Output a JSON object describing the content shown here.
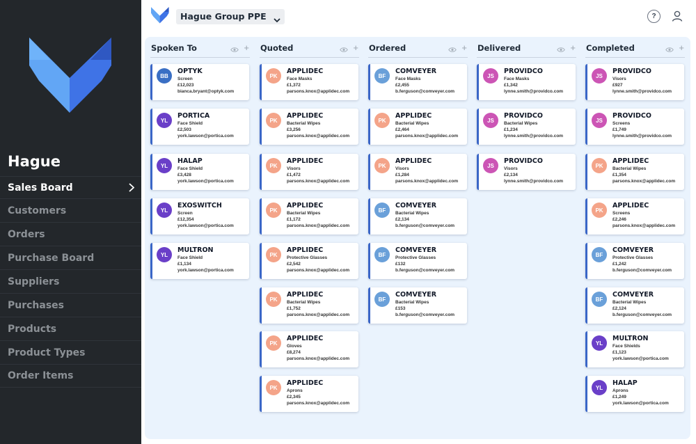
{
  "app": {
    "name": "Hague",
    "workspace": "Hague Group PPE",
    "help_label": "?"
  },
  "sidebar": {
    "items": [
      {
        "label": "Sales Board",
        "active": true
      },
      {
        "label": "Customers"
      },
      {
        "label": "Orders"
      },
      {
        "label": "Purchase Board"
      },
      {
        "label": "Suppliers"
      },
      {
        "label": "Purchases"
      },
      {
        "label": "Products"
      },
      {
        "label": "Product Types"
      },
      {
        "label": "Order Items"
      }
    ]
  },
  "colors": {
    "sidebar_bg": "#23272b",
    "board_bg": "#eaf3fd",
    "card_accent": "#3a66c7",
    "avatar_BB": "#3a6fc4",
    "avatar_YL": "#6a3fc8",
    "avatar_PK": "#f4a489",
    "avatar_BF": "#6aa0d9",
    "avatar_JS": "#cc55b5"
  },
  "board": {
    "columns": [
      {
        "title": "Spoken To",
        "cards": [
          {
            "initials": "BB",
            "company": "OPTYK",
            "product": "Screen",
            "amount": "£12,023",
            "email": "bianca.bryant@optyk.com"
          },
          {
            "initials": "YL",
            "company": "PORTICA",
            "product": "Face Shield",
            "amount": "£2,503",
            "email": "york.lawson@portica.com"
          },
          {
            "initials": "YL",
            "company": "HALAP",
            "product": "Face Shield",
            "amount": "£3,428",
            "email": "york.lawson@portica.com"
          },
          {
            "initials": "YL",
            "company": "EXOSWITCH",
            "product": "Screen",
            "amount": "£12,354",
            "email": "york.lawson@portica.com"
          },
          {
            "initials": "YL",
            "company": "MULTRON",
            "product": "Face Shield",
            "amount": "£1,134",
            "email": "york.lawson@portica.com"
          }
        ]
      },
      {
        "title": "Quoted",
        "cards": [
          {
            "initials": "PK",
            "company": "APPLIDEC",
            "product": "Face Masks",
            "amount": "£1,372",
            "email": "parsons.knox@applidec.com"
          },
          {
            "initials": "PK",
            "company": "APPLIDEC",
            "product": "Bacterial Wipes",
            "amount": "£3,256",
            "email": "parsons.knox@applidec.com"
          },
          {
            "initials": "PK",
            "company": "APPLIDEC",
            "product": "Visors",
            "amount": "£1,472",
            "email": "parsons.knox@applidec.com"
          },
          {
            "initials": "PK",
            "company": "APPLIDEC",
            "product": "Bacterial Wipes",
            "amount": "£1,172",
            "email": "parsons.knox@applidec.com"
          },
          {
            "initials": "PK",
            "company": "APPLIDEC",
            "product": "Protective Glasses",
            "amount": "£2,542",
            "email": "parsons.knox@applidec.com"
          },
          {
            "initials": "PK",
            "company": "APPLIDEC",
            "product": "Bacterial Wipes",
            "amount": "£1,752",
            "email": "parsons.knox@applidec.com"
          },
          {
            "initials": "PK",
            "company": "APPLIDEC",
            "product": "Gloves",
            "amount": "£8,274",
            "email": "parsons.knox@applidec.com"
          },
          {
            "initials": "PK",
            "company": "APPLIDEC",
            "product": "Aprons",
            "amount": "£2,345",
            "email": "parsons.knox@applidec.com"
          }
        ]
      },
      {
        "title": "Ordered",
        "cards": [
          {
            "initials": "BF",
            "company": "COMVEYER",
            "product": "Face Masks",
            "amount": "£2,455",
            "email": "b.ferguson@comveyer.com"
          },
          {
            "initials": "PK",
            "company": "APPLIDEC",
            "product": "Bacterial Wipes",
            "amount": "£2,464",
            "email": "parsons.knox@applidec.com"
          },
          {
            "initials": "PK",
            "company": "APPLIDEC",
            "product": "Visors",
            "amount": "£1,284",
            "email": "parsons.knox@applidec.com"
          },
          {
            "initials": "BF",
            "company": "COMVEYER",
            "product": "Bacterial Wipes",
            "amount": "£2,134",
            "email": "b.ferguson@comveyer.com"
          },
          {
            "initials": "BF",
            "company": "COMVEYER",
            "product": "Protective Glasses",
            "amount": "£132",
            "email": "b.ferguson@comveyer.com"
          },
          {
            "initials": "BF",
            "company": "COMVEYER",
            "product": "Bacterial Wipes",
            "amount": "£153",
            "email": "b.ferguson@comveyer.com"
          }
        ]
      },
      {
        "title": "Delivered",
        "cards": [
          {
            "initials": "JS",
            "company": "PROVIDCO",
            "product": "Face Masks",
            "amount": "£1,342",
            "email": "lynne.smith@providco.com"
          },
          {
            "initials": "JS",
            "company": "PROVIDCO",
            "product": "Bacterial Wipes",
            "amount": "£1,234",
            "email": "lynne.smith@providco.com"
          },
          {
            "initials": "JS",
            "company": "PROVIDCO",
            "product": "Visors",
            "amount": "£2,134",
            "email": "lynne.smith@providco.com"
          }
        ]
      },
      {
        "title": "Completed",
        "cards": [
          {
            "initials": "JS",
            "company": "PROVIDCO",
            "product": "Visors",
            "amount": "£927",
            "email": "lynne.smith@providco.com"
          },
          {
            "initials": "JS",
            "company": "PROVIDCO",
            "product": "Screens",
            "amount": "£1,749",
            "email": "lynne.smith@providco.com"
          },
          {
            "initials": "PK",
            "company": "APPLIDEC",
            "product": "Bacterial Wipes",
            "amount": "£1,354",
            "email": "parsons.knox@applidec.com"
          },
          {
            "initials": "PK",
            "company": "APPLIDEC",
            "product": "Screens",
            "amount": "£2,246",
            "email": "parsons.knox@applidec.com"
          },
          {
            "initials": "BF",
            "company": "COMVEYER",
            "product": "Protective Glasses",
            "amount": "£1,242",
            "email": "b.ferguson@comveyer.com"
          },
          {
            "initials": "BF",
            "company": "COMVEYER",
            "product": "Bacterial Wipes",
            "amount": "£2,124",
            "email": "b.ferguson@comveyer.com"
          },
          {
            "initials": "YL",
            "company": "MULTRON",
            "product": "Face Shields",
            "amount": "£1,123",
            "email": "york.lawson@portica.com"
          },
          {
            "initials": "YL",
            "company": "HALAP",
            "product": "Aprons",
            "amount": "£1,249",
            "email": "york.lawson@portica.com"
          }
        ]
      }
    ]
  }
}
